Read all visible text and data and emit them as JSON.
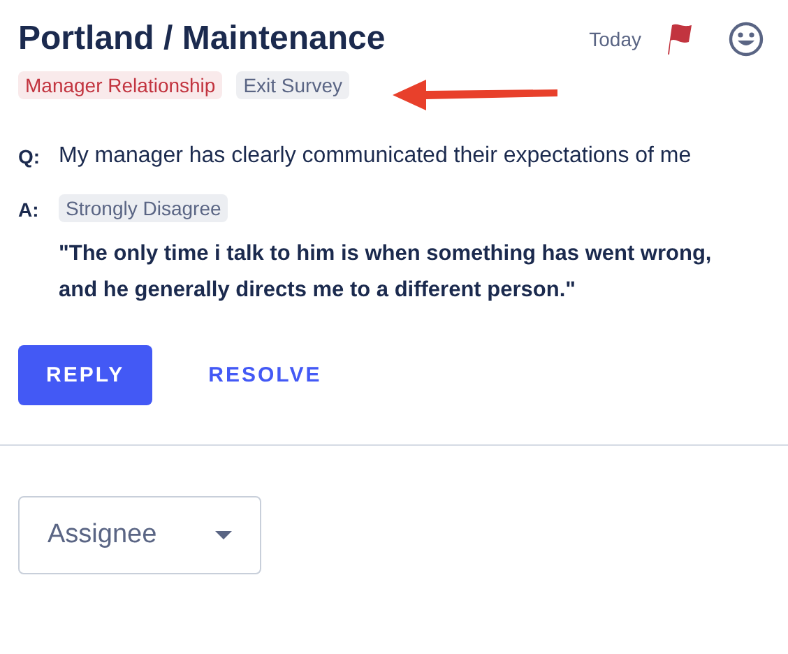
{
  "header": {
    "title": "Portland / Maintenance",
    "date": "Today"
  },
  "tags": [
    {
      "label": "Manager Relationship",
      "color": "#c2343f"
    },
    {
      "label": "Exit Survey",
      "color": "#5a6584"
    }
  ],
  "question": {
    "prefix": "Q:",
    "text": "My manager has clearly communicated their expectations of me"
  },
  "answer": {
    "prefix": "A:",
    "rating": "Strongly Disagree",
    "comment": "\"The only time i talk to him is when something has went wrong, and he generally directs me to a different person.\""
  },
  "buttons": [
    {
      "label": "REPLY",
      "kind": "primary"
    },
    {
      "label": "RESOLVE",
      "kind": "text"
    }
  ],
  "assignee": {
    "placeholder": "Assignee"
  }
}
